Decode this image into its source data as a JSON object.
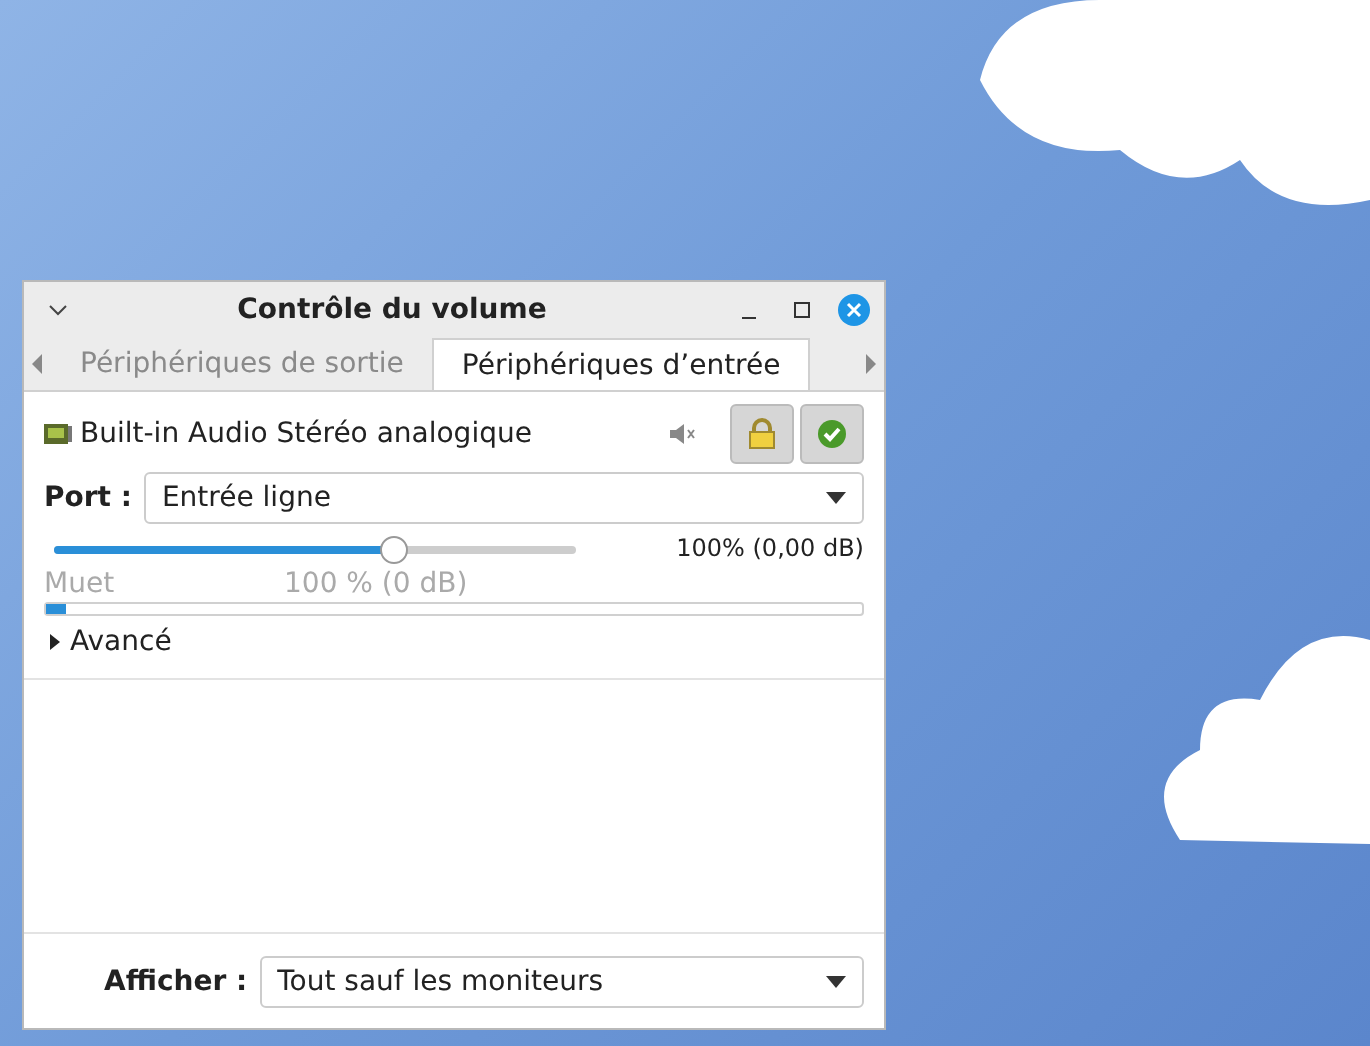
{
  "window": {
    "title": "Contrôle du volume"
  },
  "tabs": [
    {
      "label": "Périphériques de sortie",
      "selected": false
    },
    {
      "label": "Périphériques d’entrée",
      "selected": true
    }
  ],
  "device": {
    "name": "Built-in Audio Stéréo analogique",
    "lock_pressed": true,
    "default_pressed": true,
    "port_label": "Port :",
    "port_value": "Entrée ligne",
    "slider": {
      "level": 0.65,
      "reading": "100% (0,00 dB)",
      "marks": [
        "Muet",
        "100 % (0 dB)"
      ]
    },
    "meter": {
      "level": 0.025
    },
    "advanced": {
      "label": "Avancé",
      "expanded": false
    }
  },
  "footer": {
    "label": "Afficher :",
    "value": "Tout sauf les moniteurs"
  }
}
